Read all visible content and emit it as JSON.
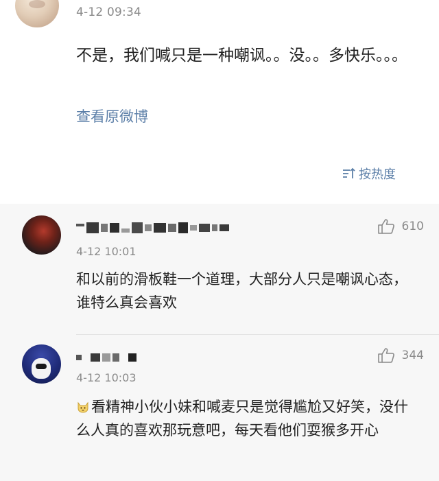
{
  "post": {
    "time": "4-12 09:34",
    "body": "不是，我们喊只是一种嘲讽。。没。。多快乐。。。",
    "link_label": "查看原微博",
    "sort_label": "按热度"
  },
  "comments": [
    {
      "time": "4-12 10:01",
      "likes": "610",
      "body": "和以前的滑板鞋一个道理，大部分人只是嘲讽心态，谁特么真会喜欢"
    },
    {
      "time": "4-12 10:03",
      "likes": "344",
      "emoji": "cat-emoji",
      "body": "看精神小伙小妹和喊麦只是觉得尴尬又好笑，没什么人真的喜欢那玩意吧，每天看他们耍猴多开心"
    }
  ],
  "colors": {
    "link": "#5c7fa8",
    "meta": "#8a8a8a",
    "text": "#222222",
    "comments_bg": "#f7f7f7"
  }
}
